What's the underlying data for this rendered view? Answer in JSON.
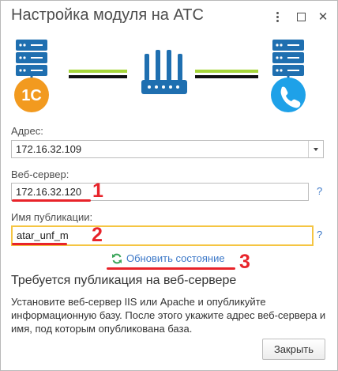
{
  "window": {
    "title": "Настройка модуля на АТС"
  },
  "address": {
    "label": "Адрес:",
    "value": "172.16.32.109"
  },
  "webserver": {
    "label": "Веб-сервер:",
    "value": "172.16.32.120",
    "help": "?",
    "marker": "1"
  },
  "publication": {
    "label": "Имя публикации:",
    "value": "atar_unf_m",
    "help": "?",
    "marker": "2"
  },
  "refresh": {
    "label": "Обновить состояние",
    "marker": "3"
  },
  "info": {
    "heading": "Требуется публикация на веб-сервере",
    "text": "Установите веб-сервер IIS или Apache и опубликуйте информационную базу. После этого укажите адрес веб-сервера и имя, под которым опубликована база."
  },
  "buttons": {
    "close": "Закрыть"
  },
  "illustration": {
    "left_badge": "1С",
    "icons": [
      "server-icon",
      "onec-logo-icon",
      "router-icon",
      "server-icon",
      "phone-icon"
    ]
  },
  "colors": {
    "accent_yellow": "#f5c542",
    "link_blue": "#3c78c8",
    "marker_red": "#e8232a",
    "line_green": "#a6d63a",
    "badge_orange": "#f29a1f",
    "phone_blue": "#1ea1e8",
    "server_blue": "#1f6fb0"
  }
}
